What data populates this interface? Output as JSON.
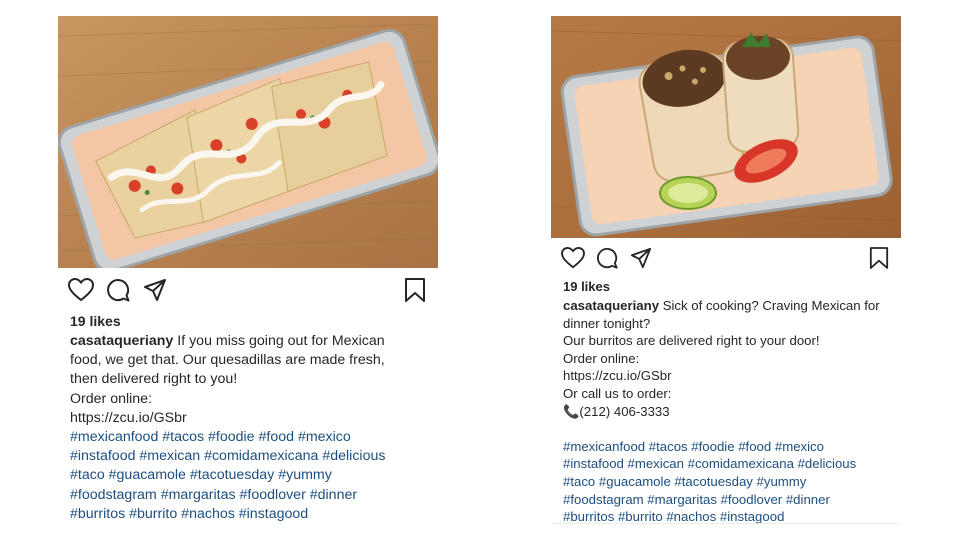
{
  "posts": [
    {
      "photo_alt": "",
      "likes": "19 likes",
      "username": "casataqueriany",
      "caption_lines": [
        "If you miss going out for Mexican",
        "food, we get that. Our quesadillas are made fresh,",
        "then delivered right to you!",
        "Order online:",
        "https://zcu.io/GSbr"
      ],
      "hashtag_lines": [
        "#mexicanfood #tacos #foodie #food #mexico",
        "#instafood #mexican #comidamexicana #delicious",
        "#taco #guacamole #tacotuesday #yummy",
        "#foodstagram #margaritas #foodlover #dinner",
        "#burritos #burrito #nachos #instagood"
      ]
    },
    {
      "photo_alt": "",
      "likes": "19 likes",
      "username": "casataqueriany",
      "caption_lines": [
        "Sick of cooking? Craving Mexican for",
        "dinner tonight?",
        "Our burritos are delivered right to your door!",
        "Order online:",
        "https://zcu.io/GSbr",
        "Or call us to order:",
        "📞(212) 406-3333"
      ],
      "hashtag_lines": [
        "#mexicanfood #tacos #foodie #food #mexico",
        "#instafood #mexican #comidamexicana #delicious",
        "#taco #guacamole #tacotuesday #yummy",
        "#foodstagram #margaritas #foodlover #dinner",
        "#burritos #burrito #nachos #instagood"
      ]
    }
  ],
  "icons": [
    "heart-icon",
    "comment-icon",
    "share-icon",
    "bookmark-icon"
  ],
  "colors": {
    "hashtag": "#1d4f80",
    "text": "#262626"
  }
}
